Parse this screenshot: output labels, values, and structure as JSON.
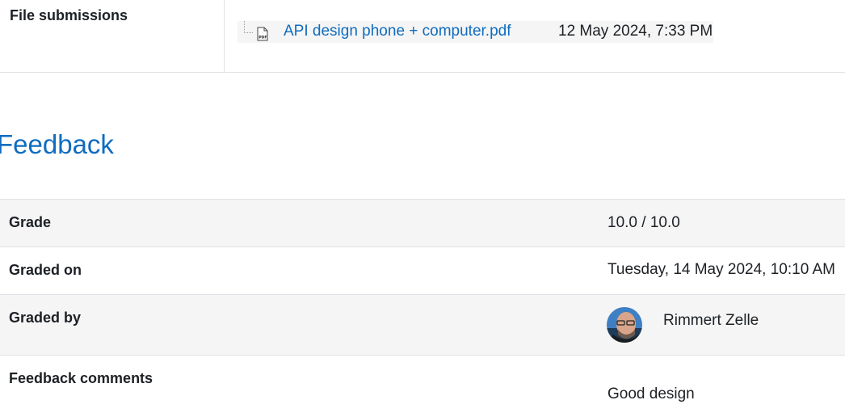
{
  "submission": {
    "label": "File submissions",
    "file": {
      "icon": "pdf-file-icon",
      "name": "API design phone + computer.pdf",
      "date": "12 May 2024, 7:33 PM"
    }
  },
  "feedback": {
    "heading": "Feedback",
    "grade_label": "Grade",
    "grade_value": "10.0 / 10.0",
    "graded_on_label": "Graded on",
    "graded_on_value": "Tuesday, 14 May 2024, 10:10 AM",
    "graded_by_label": "Graded by",
    "grader_name": "Rimmert Zelle",
    "comments_label": "Feedback comments",
    "comments_value": "Good design"
  },
  "colors": {
    "link": "#0f6cbf",
    "text": "#1d2125",
    "row_shade": "#f5f5f5",
    "border": "#dee2e6"
  }
}
